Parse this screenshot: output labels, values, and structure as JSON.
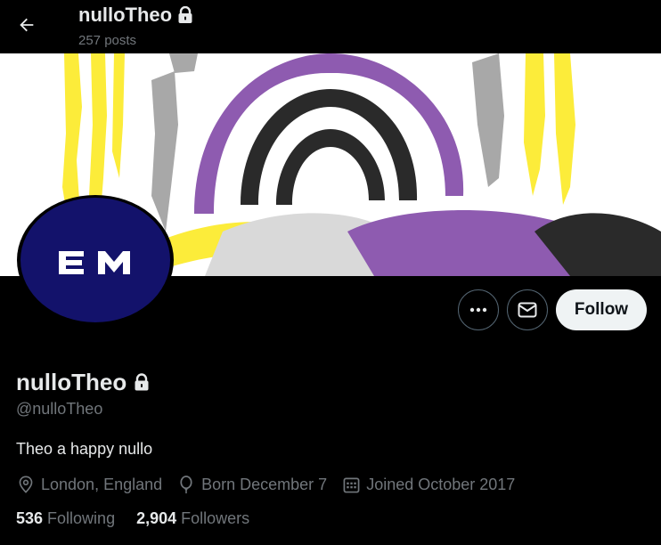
{
  "header": {
    "title": "nulloTheo",
    "posts_count": "257 posts"
  },
  "avatar": {
    "monogram": "EM",
    "bg_color": "#13126b"
  },
  "actions": {
    "follow_label": "Follow"
  },
  "profile": {
    "display_name": "nulloTheo",
    "handle": "@nulloTheo",
    "bio": "Theo a happy nullo",
    "location": "London, England",
    "birthday": "Born December 7",
    "joined": "Joined October 2017"
  },
  "stats": {
    "following_count": "536",
    "following_label": "Following",
    "followers_count": "2,904",
    "followers_label": "Followers"
  },
  "icons": {
    "back": "arrow-left-icon",
    "lock": "lock-icon",
    "more": "more-dots-icon",
    "message": "envelope-icon",
    "location": "map-pin-icon",
    "birthday": "balloon-icon",
    "calendar": "calendar-icon"
  },
  "colors": {
    "background": "#000000",
    "text_primary": "#e7e9ea",
    "text_secondary": "#71767b",
    "button_border": "#536471",
    "follow_bg": "#eff3f4",
    "banner_yellow": "#fff433",
    "banner_purple": "#9b59b6",
    "banner_gray": "#aaaaaa",
    "banner_black": "#2c2c2c"
  }
}
